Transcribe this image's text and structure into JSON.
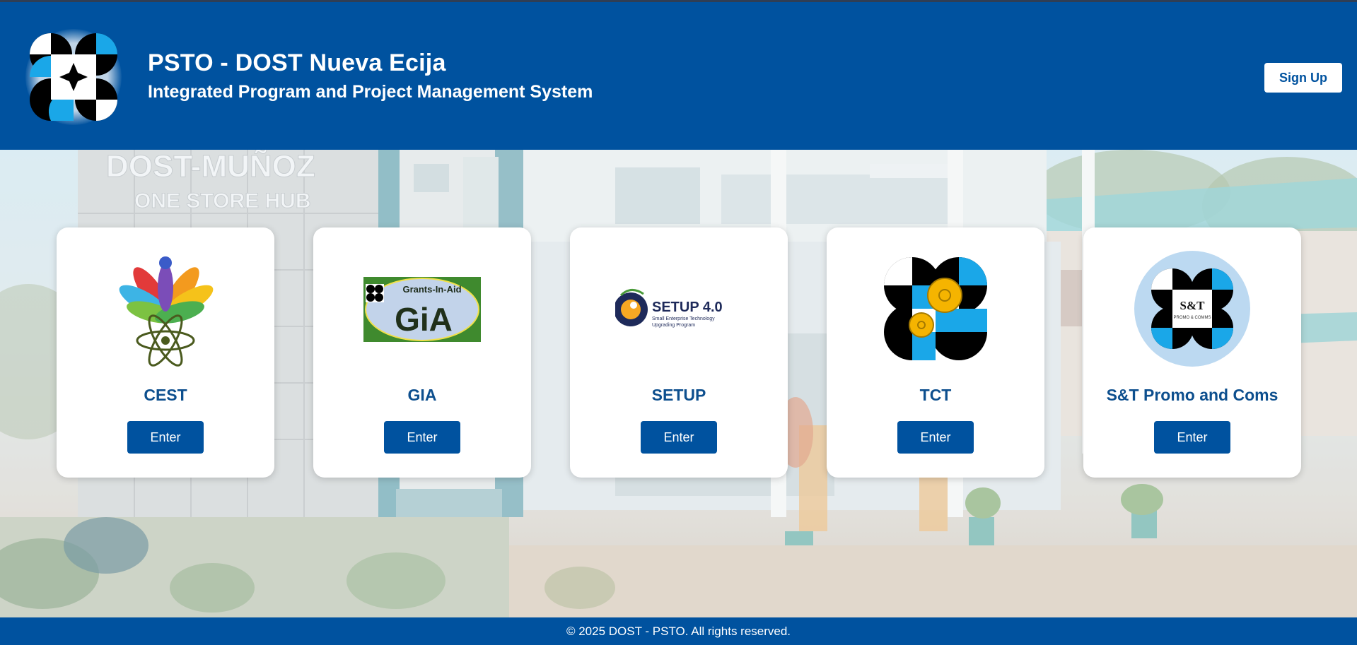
{
  "header": {
    "title": "PSTO - DOST Nueva Ecija",
    "subtitle": "Integrated Program and Project Management System",
    "signup_label": "Sign Up"
  },
  "background": {
    "building_sign_line1": "DOST-MUÑOZ",
    "building_sign_line2": "ONE STORE HUB"
  },
  "programs": [
    {
      "name": "CEST",
      "button": "Enter",
      "icon": "cest-logo-icon"
    },
    {
      "name": "GIA",
      "button": "Enter",
      "icon": "gia-logo-icon",
      "logo_text": "Grants-In-Aid",
      "logo_mark": "GiA"
    },
    {
      "name": "SETUP",
      "button": "Enter",
      "icon": "setup-logo-icon",
      "logo_title": "SETUP 4.0",
      "logo_line1": "Small Enterprise Technology",
      "logo_line2": "Upgrading Program"
    },
    {
      "name": "TCT",
      "button": "Enter",
      "icon": "tct-logo-icon"
    },
    {
      "name": "S&T Promo and Coms",
      "button": "Enter",
      "icon": "st-promo-logo-icon",
      "logo_mark": "S&T",
      "logo_sub": "PROMO & COMMS"
    }
  ],
  "footer": {
    "copyright": "© 2025 DOST - PSTO. All rights reserved."
  },
  "colors": {
    "primary": "#00529f",
    "title_text": "#0d4f8e",
    "dost_cyan": "#1aa7e8"
  }
}
